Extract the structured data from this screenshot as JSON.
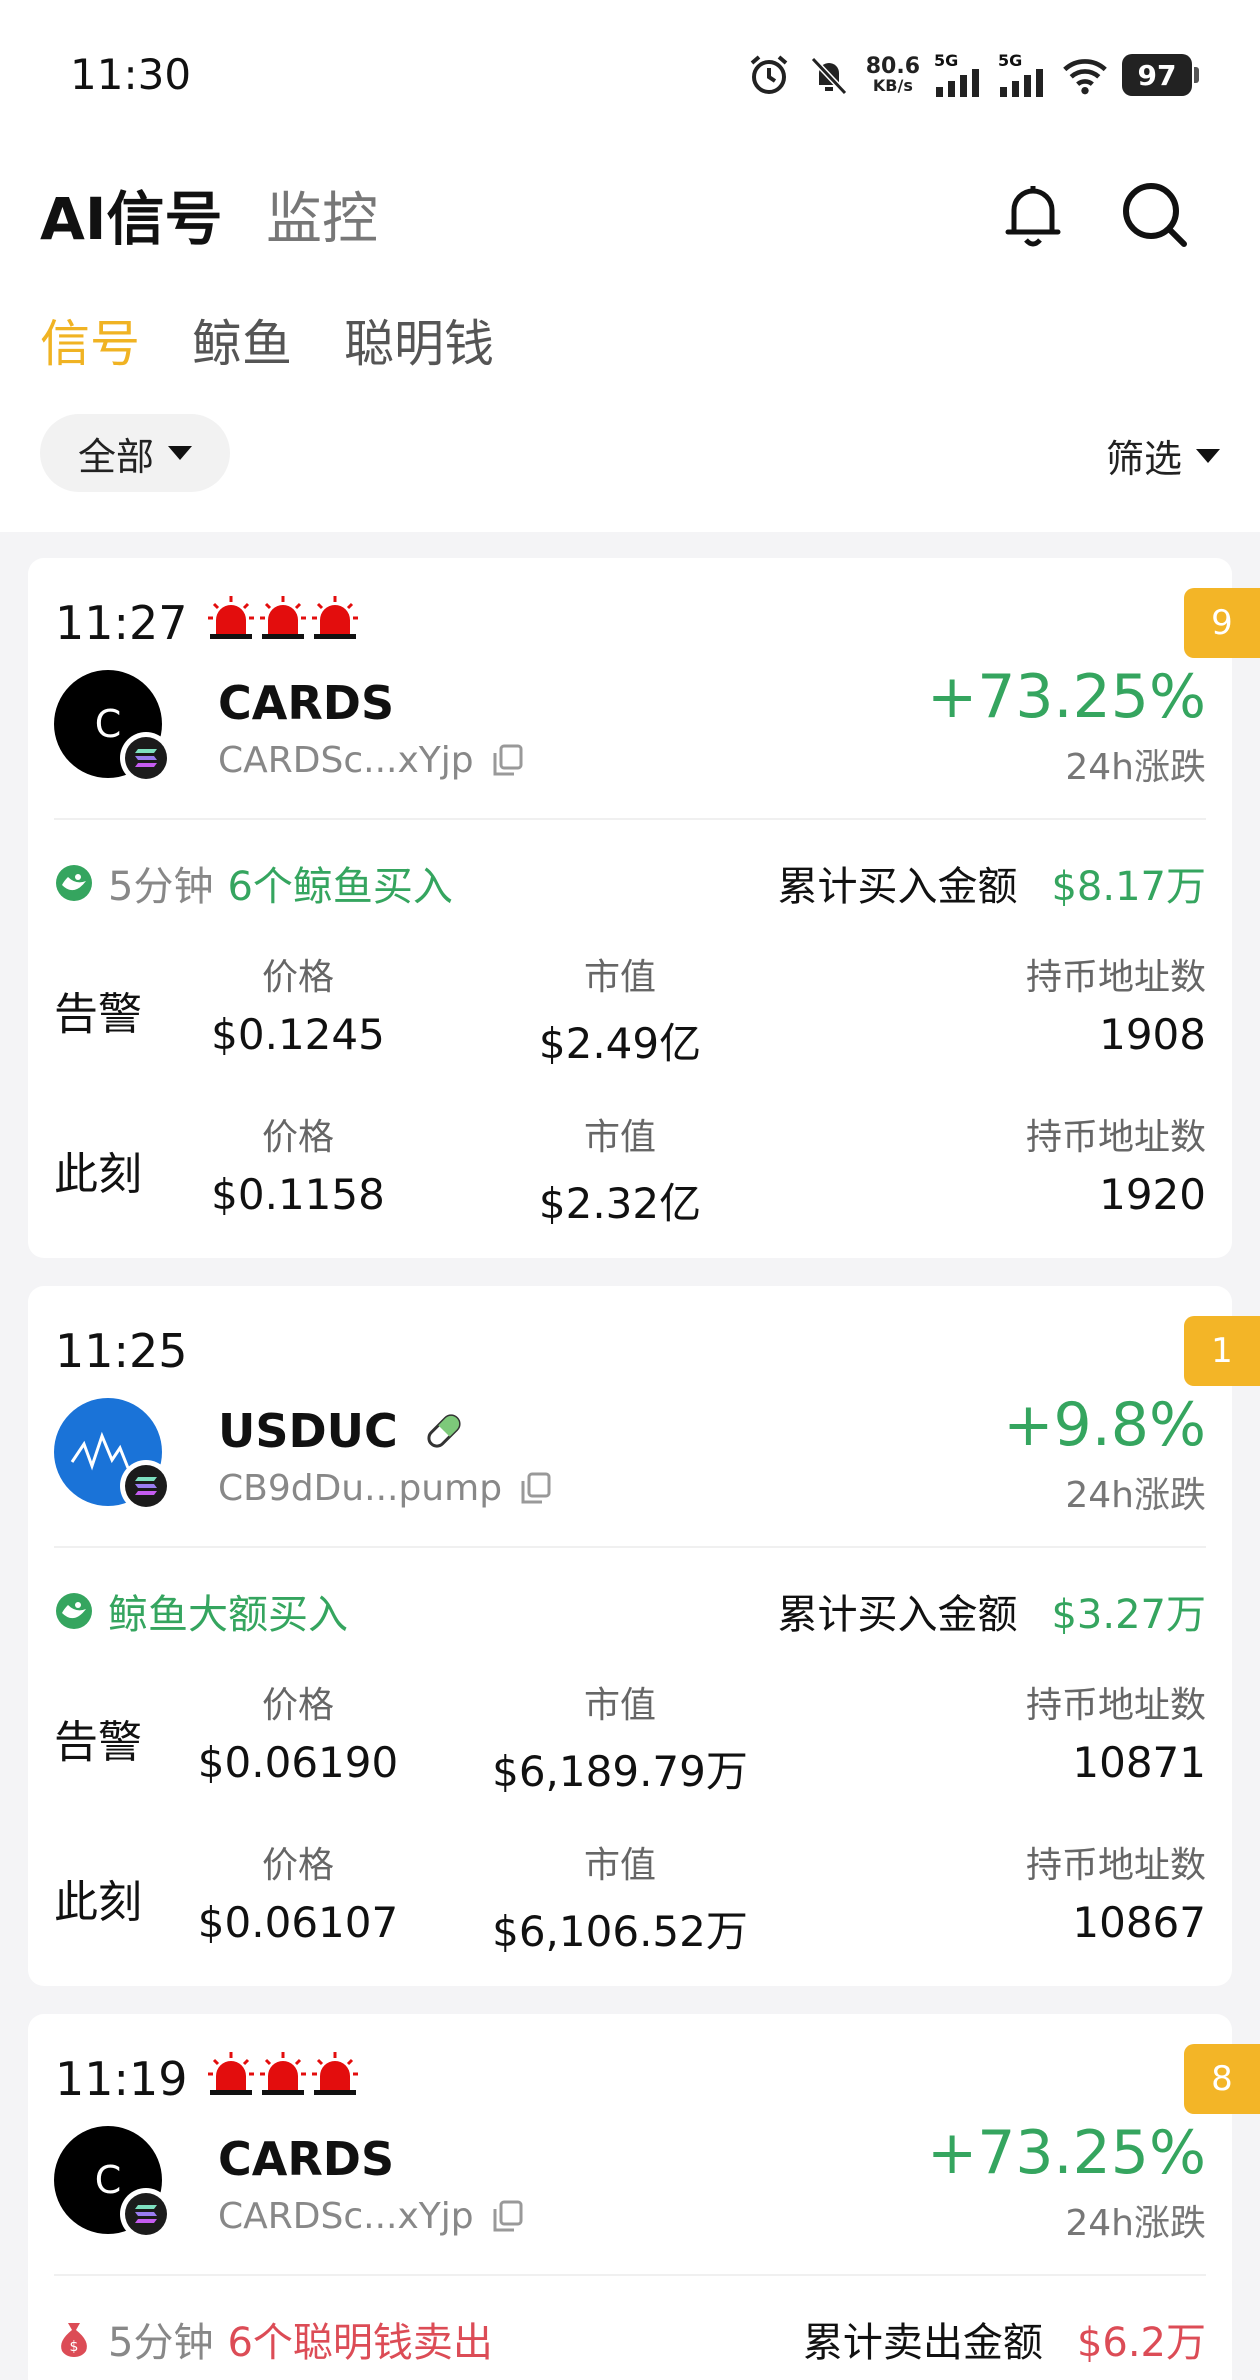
{
  "status_bar": {
    "time": "11:30",
    "net_speed": "80.6",
    "net_unit": "KB/s",
    "sig1": "5G",
    "sig2": "5G",
    "battery": "97"
  },
  "header": {
    "title_main": "AI信号",
    "title_sub": "监控"
  },
  "tabs": [
    {
      "label": "信号",
      "active": true
    },
    {
      "label": "鲸鱼",
      "active": false
    },
    {
      "label": "聪明钱",
      "active": false
    }
  ],
  "filter": {
    "all_label": "全部",
    "screen_label": "筛选"
  },
  "cards": [
    {
      "time": "11:27",
      "sirens": 3,
      "rank": "9",
      "token_initial": "C",
      "token_name": "CARDS",
      "address": "CARDSc...xYjp",
      "change": "+73.25%",
      "change_label": "24h涨跌",
      "event_mins": "5分钟",
      "event_text": "6个鲸鱼买入",
      "total_label": "累计买入金额",
      "total_value": "$8.17万",
      "alert_label": "告警",
      "now_label": "此刻",
      "col_price": "价格",
      "col_mcap": "市值",
      "col_holders": "持币地址数",
      "alert_price": "$0.1245",
      "alert_mcap": "$2.49亿",
      "alert_holders": "1908",
      "now_price": "$0.1158",
      "now_mcap": "$2.32亿",
      "now_holders": "1920"
    },
    {
      "time": "11:25",
      "rank": "1",
      "token_name": "USDUC",
      "address": "CB9dDu...pump",
      "change": "+9.8%",
      "change_label": "24h涨跌",
      "event_text": "鲸鱼大额买入",
      "total_label": "累计买入金额",
      "total_value": "$3.27万",
      "alert_label": "告警",
      "now_label": "此刻",
      "col_price": "价格",
      "col_mcap": "市值",
      "col_holders": "持币地址数",
      "alert_price": "$0.06190",
      "alert_mcap": "$6,189.79万",
      "alert_holders": "10871",
      "now_price": "$0.06107",
      "now_mcap": "$6,106.52万",
      "now_holders": "10867"
    },
    {
      "time": "11:19",
      "sirens": 3,
      "rank": "8",
      "token_initial": "C",
      "token_name": "CARDS",
      "address": "CARDSc...xYjp",
      "change": "+73.25%",
      "change_label": "24h涨跌",
      "event_mins": "5分钟",
      "event_text": "6个聪明钱卖出",
      "total_label": "累计卖出金额",
      "total_value": "$6.2万"
    }
  ],
  "colors": {
    "accent": "#f0b323",
    "up": "#35a55f",
    "down": "#dc4c56"
  }
}
